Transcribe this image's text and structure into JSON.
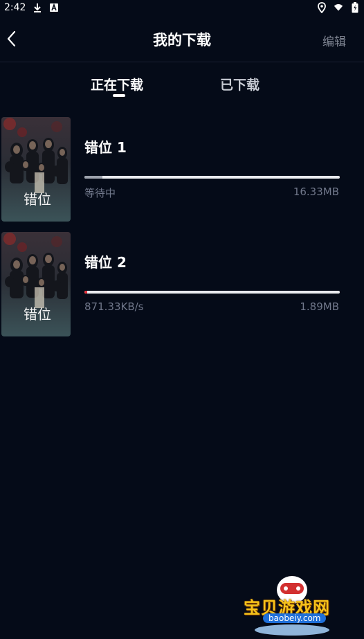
{
  "status_bar": {
    "time": "2:42",
    "icons": [
      "download-icon",
      "app-icon",
      "location-icon",
      "wifi-icon",
      "battery-icon"
    ]
  },
  "header": {
    "title": "我的下载",
    "edit_label": "编辑"
  },
  "tabs": [
    {
      "label": "正在下载",
      "active": true
    },
    {
      "label": "已下载",
      "active": false
    }
  ],
  "downloads": [
    {
      "title": "错位 1",
      "poster_text": "错位",
      "status": "等待中",
      "size": "16.33MB",
      "progress": 0.07,
      "progress_color": "#9ea3ad"
    },
    {
      "title": "错位 2",
      "poster_text": "错位",
      "status": "871.33KB/s",
      "size": "1.89MB",
      "progress": 0.01,
      "progress_color": "#e8323c"
    }
  ],
  "watermark": {
    "brand": "宝贝游戏网",
    "domain": "baobeiy.com"
  },
  "colors": {
    "background": "#050b18",
    "accent_red": "#e8323c"
  }
}
